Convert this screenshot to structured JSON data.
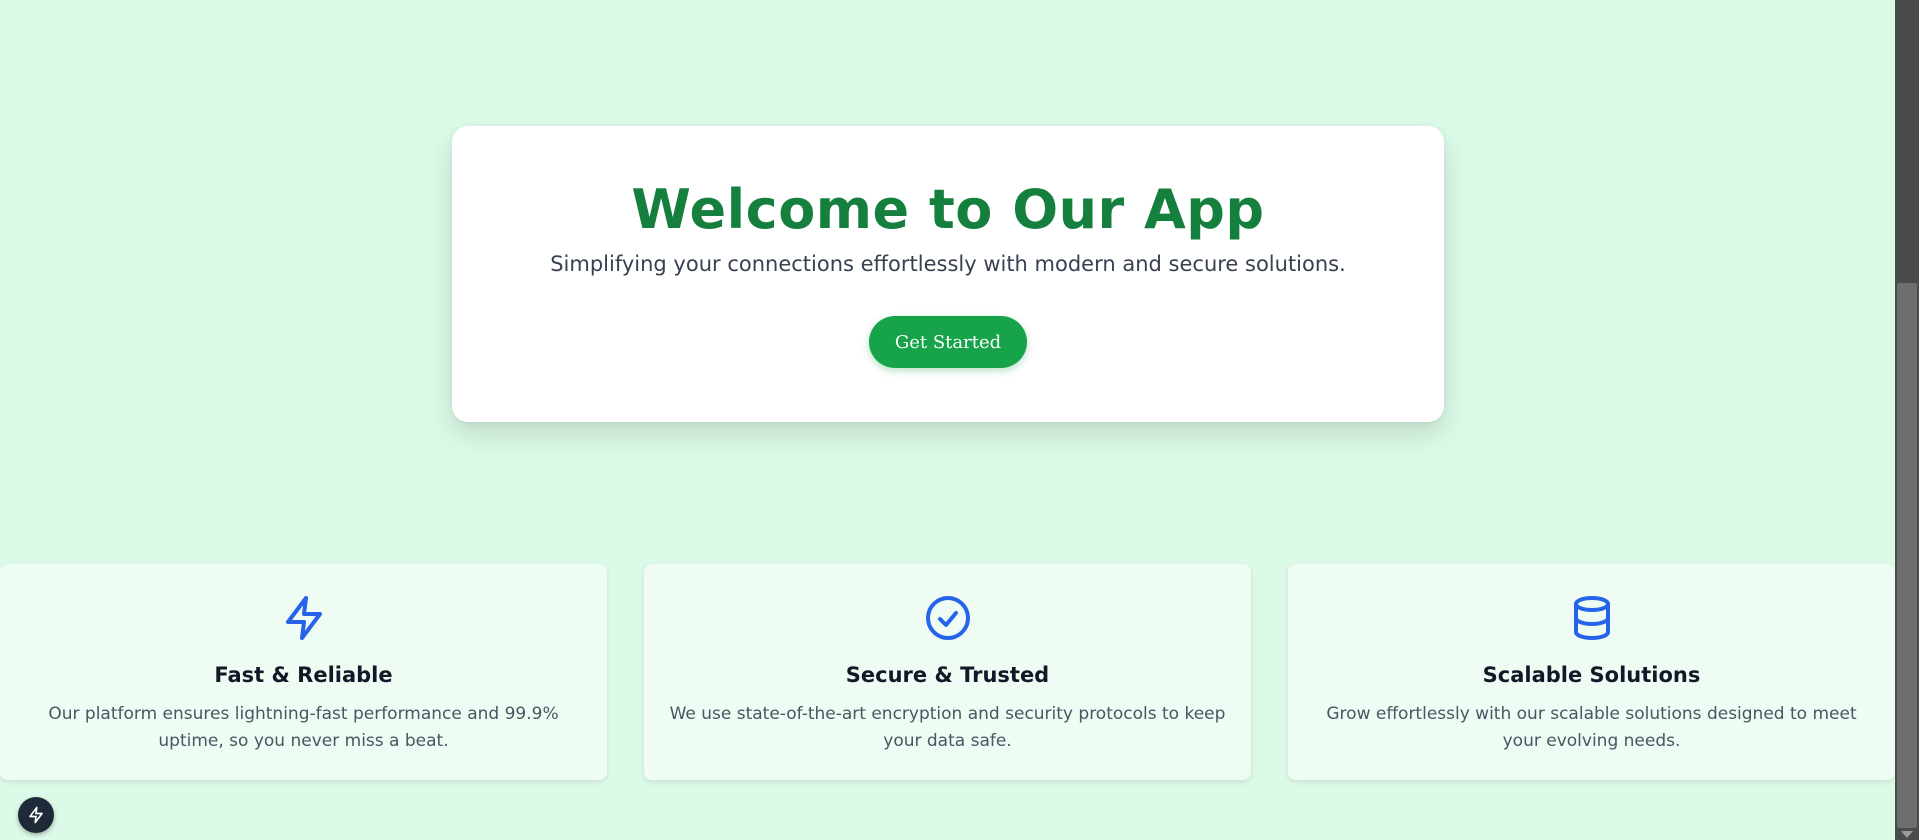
{
  "hero": {
    "title": "Welcome to Our App",
    "subtitle": "Simplifying your connections effortlessly with modern and secure solutions.",
    "cta_label": "Get Started"
  },
  "features": [
    {
      "icon": "lightning-bolt-icon",
      "title": "Fast & Reliable",
      "description": "Our platform ensures lightning-fast performance and 99.9% uptime, so you never miss a beat."
    },
    {
      "icon": "check-circle-icon",
      "title": "Secure & Trusted",
      "description": "We use state-of-the-art encryption and security protocols to keep your data safe."
    },
    {
      "icon": "database-icon",
      "title": "Scalable Solutions",
      "description": "Grow effortlessly with our scalable solutions designed to meet your evolving needs."
    }
  ],
  "colors": {
    "background": "#dcfae8",
    "title_green": "#15803d",
    "button_green": "#16a34a",
    "icon_blue": "#2563eb",
    "feature_card_bg": "#eefcf3"
  },
  "floating_button": {
    "icon": "lightning-bolt-icon"
  }
}
